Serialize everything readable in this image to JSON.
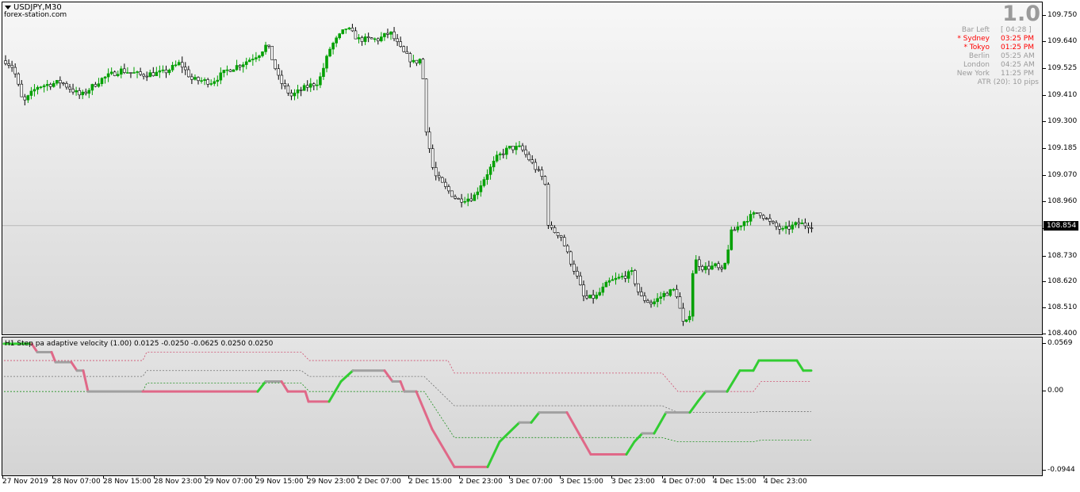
{
  "chart": {
    "symbol": "USDJPY,M30",
    "site": "forex-station.com",
    "current_price": "108.854",
    "price_axis": [
      "109.750",
      "109.640",
      "109.525",
      "109.410",
      "109.300",
      "109.185",
      "109.070",
      "108.960",
      "108.845",
      "108.730",
      "108.620",
      "108.510",
      "108.400"
    ],
    "time_axis": [
      "27 Nov 2019",
      "28 Nov 07:00",
      "28 Nov 15:00",
      "28 Nov 23:00",
      "29 Nov 07:00",
      "29 Nov 15:00",
      "29 Nov 23:00",
      "2 Dec 07:00",
      "2 Dec 15:00",
      "2 Dec 23:00",
      "3 Dec 07:00",
      "3 Dec 15:00",
      "3 Dec 23:00",
      "4 Dec 07:00",
      "4 Dec 15:00",
      "4 Dec 23:00"
    ],
    "bull_color": "#00a000",
    "bear_color": "#000000"
  },
  "info_panel": {
    "big_value": "1.0",
    "rows": [
      {
        "label": "Bar Left",
        "value": "[ 04:28 ]",
        "highlight": false
      },
      {
        "label": "* Sydney",
        "value": "03:25 PM",
        "highlight": true
      },
      {
        "label": "* Tokyo",
        "value": "01:25 PM",
        "highlight": true
      },
      {
        "label": "Berlin",
        "value": "05:25 AM",
        "highlight": false
      },
      {
        "label": "London",
        "value": "04:25 AM",
        "highlight": false
      },
      {
        "label": "New York",
        "value": "11:25 PM",
        "highlight": false
      }
    ],
    "atr": "ATR (20): 10 pips"
  },
  "indicator": {
    "title": "H1 Step pa adaptive velocity (1.00) 0.0125 -0.0250 -0.0625 0.0250 0.0250",
    "scale": [
      "0.0569",
      "0.00",
      "-0.0944"
    ],
    "colors": {
      "up": "#32cd32",
      "down": "#e06888",
      "neutral": "#a0a0a0",
      "upper_level": "#d05070",
      "lower_level": "#209020",
      "mid_level": "#707070"
    }
  },
  "chart_data": {
    "type": "candlestick",
    "price_levels": [
      109.75,
      109.64,
      109.525,
      109.41,
      109.3,
      109.185,
      109.07,
      108.96,
      108.845,
      108.73,
      108.62,
      108.51,
      108.4
    ],
    "close_path": [
      [
        0,
        109.56
      ],
      [
        10,
        109.53
      ],
      [
        22,
        109.38
      ],
      [
        40,
        109.45
      ],
      [
        70,
        109.47
      ],
      [
        95,
        109.41
      ],
      [
        120,
        109.48
      ],
      [
        145,
        109.52
      ],
      [
        170,
        109.5
      ],
      [
        200,
        109.51
      ],
      [
        220,
        109.55
      ],
      [
        235,
        109.48
      ],
      [
        260,
        109.47
      ],
      [
        280,
        109.52
      ],
      [
        300,
        109.55
      ],
      [
        320,
        109.59
      ],
      [
        330,
        109.63
      ],
      [
        345,
        109.48
      ],
      [
        360,
        109.41
      ],
      [
        380,
        109.45
      ],
      [
        395,
        109.47
      ],
      [
        410,
        109.62
      ],
      [
        430,
        109.7
      ],
      [
        445,
        109.65
      ],
      [
        470,
        109.65
      ],
      [
        485,
        109.68
      ],
      [
        500,
        109.6
      ],
      [
        515,
        109.55
      ],
      [
        525,
        109.57
      ],
      [
        530,
        109.28
      ],
      [
        540,
        109.08
      ],
      [
        555,
        109.02
      ],
      [
        570,
        108.97
      ],
      [
        590,
        108.98
      ],
      [
        605,
        109.07
      ],
      [
        620,
        109.15
      ],
      [
        635,
        109.19
      ],
      [
        650,
        109.19
      ],
      [
        665,
        109.12
      ],
      [
        680,
        109.05
      ],
      [
        685,
        108.85
      ],
      [
        700,
        108.82
      ],
      [
        710,
        108.73
      ],
      [
        720,
        108.65
      ],
      [
        730,
        108.55
      ],
      [
        745,
        108.56
      ],
      [
        760,
        108.62
      ],
      [
        775,
        108.64
      ],
      [
        790,
        108.66
      ],
      [
        800,
        108.56
      ],
      [
        815,
        108.53
      ],
      [
        830,
        108.57
      ],
      [
        845,
        108.59
      ],
      [
        855,
        108.44
      ],
      [
        862,
        108.46
      ],
      [
        868,
        108.72
      ],
      [
        880,
        108.68
      ],
      [
        895,
        108.69
      ],
      [
        905,
        108.66
      ],
      [
        915,
        108.83
      ],
      [
        935,
        108.89
      ],
      [
        950,
        108.92
      ],
      [
        965,
        108.87
      ],
      [
        980,
        108.84
      ],
      [
        1000,
        108.87
      ],
      [
        1018,
        108.86
      ]
    ],
    "indicator_step": [
      [
        0,
        0.057
      ],
      [
        35,
        0.057
      ],
      [
        42,
        0.047
      ],
      [
        60,
        0.047
      ],
      [
        65,
        0.035
      ],
      [
        85,
        0.035
      ],
      [
        92,
        0.025
      ],
      [
        100,
        0.025
      ],
      [
        106,
        0.0
      ],
      [
        175,
        0.0
      ],
      [
        320,
        0.0
      ],
      [
        330,
        0.012
      ],
      [
        350,
        0.012
      ],
      [
        358,
        0.0
      ],
      [
        380,
        0.0
      ],
      [
        384,
        -0.012
      ],
      [
        410,
        -0.012
      ],
      [
        425,
        0.012
      ],
      [
        440,
        0.025
      ],
      [
        480,
        0.025
      ],
      [
        490,
        0.012
      ],
      [
        500,
        0.012
      ],
      [
        505,
        0.0
      ],
      [
        520,
        0.0
      ],
      [
        540,
        -0.045
      ],
      [
        568,
        -0.09
      ],
      [
        610,
        -0.09
      ],
      [
        625,
        -0.06
      ],
      [
        650,
        -0.037
      ],
      [
        665,
        -0.037
      ],
      [
        675,
        -0.025
      ],
      [
        710,
        -0.025
      ],
      [
        740,
        -0.075
      ],
      [
        785,
        -0.075
      ],
      [
        795,
        -0.06
      ],
      [
        805,
        -0.05
      ],
      [
        820,
        -0.05
      ],
      [
        835,
        -0.025
      ],
      [
        865,
        -0.025
      ],
      [
        875,
        -0.012
      ],
      [
        885,
        0.0
      ],
      [
        912,
        0.0
      ],
      [
        928,
        0.025
      ],
      [
        945,
        0.025
      ],
      [
        952,
        0.037
      ],
      [
        1000,
        0.037
      ],
      [
        1008,
        0.025
      ],
      [
        1018,
        0.025
      ]
    ],
    "upper_level": [
      [
        0,
        0.037
      ],
      [
        175,
        0.037
      ],
      [
        180,
        0.047
      ],
      [
        375,
        0.047
      ],
      [
        385,
        0.037
      ],
      [
        560,
        0.037
      ],
      [
        568,
        0.022
      ],
      [
        830,
        0.022
      ],
      [
        850,
        0.0
      ],
      [
        945,
        0.0
      ],
      [
        955,
        0.012
      ],
      [
        1018,
        0.012
      ]
    ],
    "mid_level": [
      [
        0,
        0.018
      ],
      [
        175,
        0.018
      ],
      [
        180,
        0.025
      ],
      [
        375,
        0.025
      ],
      [
        385,
        0.018
      ],
      [
        530,
        0.018
      ],
      [
        568,
        -0.017
      ],
      [
        830,
        -0.017
      ],
      [
        850,
        -0.025
      ],
      [
        945,
        -0.025
      ],
      [
        955,
        -0.024
      ],
      [
        1018,
        -0.024
      ]
    ],
    "lower_level": [
      [
        0,
        0.0
      ],
      [
        175,
        0.0
      ],
      [
        180,
        0.01
      ],
      [
        375,
        0.01
      ],
      [
        385,
        0.0
      ],
      [
        530,
        0.0
      ],
      [
        568,
        -0.055
      ],
      [
        830,
        -0.055
      ],
      [
        850,
        -0.06
      ],
      [
        945,
        -0.06
      ],
      [
        955,
        -0.058
      ],
      [
        1018,
        -0.058
      ]
    ]
  }
}
